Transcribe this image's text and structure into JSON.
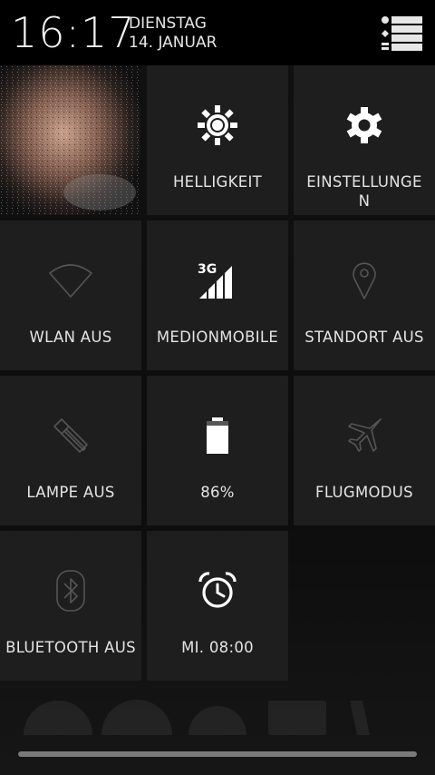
{
  "status": {
    "time": "16:17",
    "weekday": "DIENSTAG",
    "date": "14. JANUAR"
  },
  "header_button_icon": "list-settings-icon",
  "tiles": {
    "avatar": {
      "icon": "profile-photo"
    },
    "brightness": {
      "label": "HELLIGKEIT",
      "icon": "sun-icon"
    },
    "settings": {
      "label": "EINSTELLUNGE\nN",
      "icon": "gear-icon"
    },
    "wifi": {
      "label": "WLAN AUS",
      "icon": "wifi-off-icon"
    },
    "mobile": {
      "label": "MEDIONMOBILE",
      "icon": "signal-3g-icon",
      "network": "3G"
    },
    "location": {
      "label": "STANDORT AUS",
      "icon": "location-off-icon"
    },
    "flashlight": {
      "label": "LAMPE AUS",
      "icon": "flashlight-icon"
    },
    "battery": {
      "label": "86%",
      "icon": "battery-icon",
      "level_percent": 86
    },
    "airplane": {
      "label": "FLUGMODUS",
      "icon": "airplane-icon"
    },
    "bluetooth": {
      "label": "BLUETOOTH AUS",
      "icon": "bluetooth-off-icon"
    },
    "alarm": {
      "label": "MI. 08:00",
      "icon": "alarm-icon"
    }
  },
  "colors": {
    "tile_bg": "#1e1e1e",
    "active_icon": "#ffffff",
    "inactive_icon": "#5a5a5a"
  }
}
